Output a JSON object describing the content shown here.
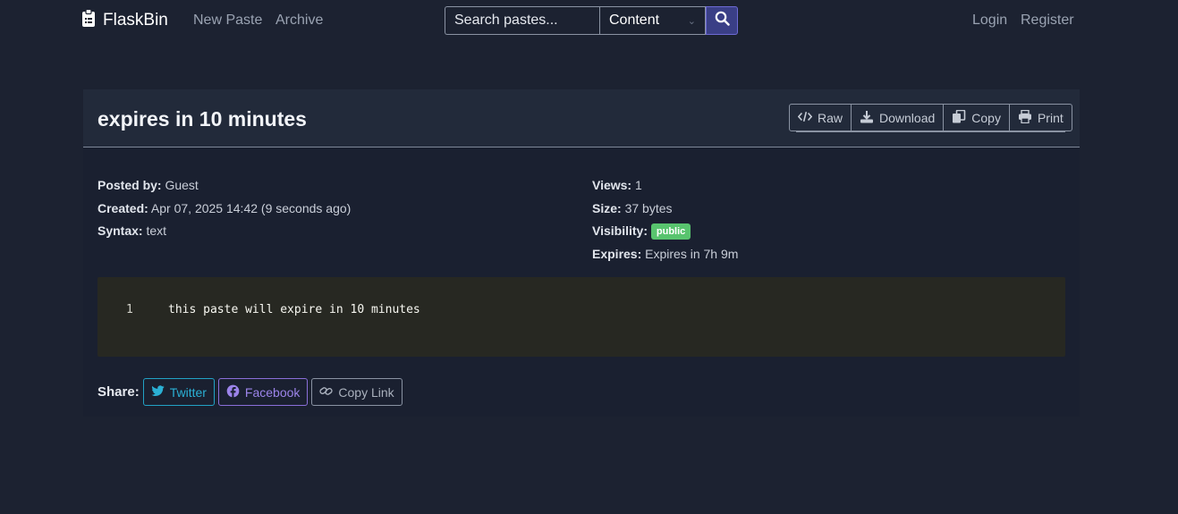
{
  "nav": {
    "brand": "FlaskBin",
    "links": [
      "New Paste",
      "Archive"
    ],
    "search_placeholder": "Search pastes...",
    "search_scope": "Content",
    "auth": [
      "Login",
      "Register"
    ]
  },
  "paste": {
    "title": "expires in 10 minutes",
    "actions": [
      "Raw",
      "Download",
      "Copy",
      "Print"
    ],
    "meta_left": [
      {
        "label": "Posted by:",
        "value": "Guest"
      },
      {
        "label": "Created:",
        "value": "Apr 07, 2025 14:42 (9 seconds ago)"
      },
      {
        "label": "Syntax:",
        "value": "text"
      }
    ],
    "meta_right": {
      "views_label": "Views:",
      "views": "1",
      "size_label": "Size:",
      "size": "37 bytes",
      "visibility_label": "Visibility:",
      "visibility": "public",
      "expires_label": "Expires:",
      "expires": "Expires in 7h 9m"
    },
    "code": {
      "line_number": "1",
      "line_text": "this paste will expire in 10 minutes"
    },
    "share": {
      "label": "Share:",
      "twitter": "Twitter",
      "facebook": "Facebook",
      "copy_link": "Copy Link"
    }
  },
  "colors": {
    "background": "#1c2231",
    "card_header": "#222a3a",
    "code_background": "#272822",
    "badge_public": "#58c46e",
    "search_button": "#3a3f86"
  },
  "icons": [
    "clipboard-icon",
    "search-icon",
    "code-icon",
    "download-icon",
    "copy-icon",
    "print-icon",
    "twitter-icon",
    "facebook-icon",
    "link-icon"
  ]
}
